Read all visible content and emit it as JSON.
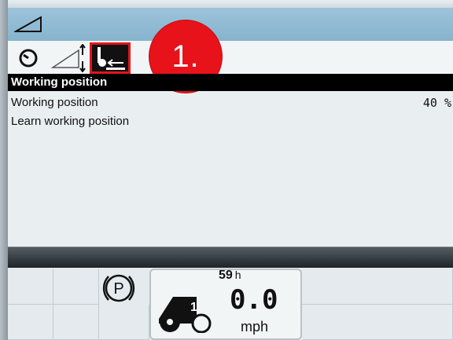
{
  "tabs": [
    {
      "name": "gauge",
      "icon": "gauge-icon"
    },
    {
      "name": "slope",
      "icon": "slope-adjust-icon"
    },
    {
      "name": "working-position",
      "icon": "working-position-icon",
      "selected": true
    }
  ],
  "callout": {
    "label": "1."
  },
  "section": {
    "title": "Working position"
  },
  "rows": [
    {
      "label": "Working position",
      "value": "40 %"
    },
    {
      "label": "Learn working position",
      "value": ""
    }
  ],
  "status": {
    "parking": "P",
    "hours_value": "59",
    "hours_unit": "h",
    "gear": "1",
    "speed": "0.0",
    "speed_unit": "mph"
  },
  "colors": {
    "highlight": "#e0161b",
    "callout": "#e8121a",
    "header_bg": "#000000"
  }
}
